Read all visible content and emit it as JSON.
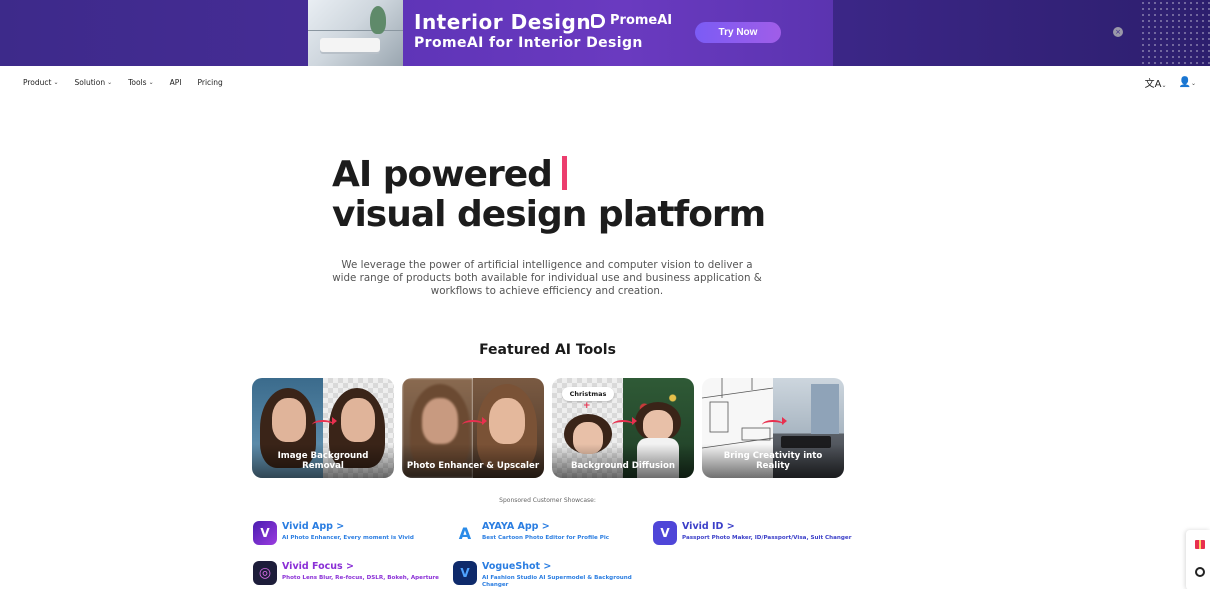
{
  "banner": {
    "title": "Interior Design",
    "subtitle": "PromeAI for Interior Design",
    "brand": "PromeAI",
    "cta": "Try Now",
    "close_glyph": "×"
  },
  "nav": {
    "items": [
      {
        "label": "Product",
        "caret": true
      },
      {
        "label": "Solution",
        "caret": true
      },
      {
        "label": "Tools",
        "caret": true
      },
      {
        "label": "API",
        "caret": false
      },
      {
        "label": "Pricing",
        "caret": false
      }
    ],
    "language_icon": "translate-icon",
    "language_glyph": "文A",
    "user_icon": "user-icon",
    "user_glyph": "👤"
  },
  "hero": {
    "title_line1": "AI powered",
    "title_line2": "visual design platform",
    "description": "We leverage the power of artificial intelligence and computer vision to deliver a wide range of products both available for individual use and business application & workflows to achieve efficiency and creation."
  },
  "featured": {
    "heading": "Featured AI Tools",
    "tools": [
      {
        "label": "Image Background Removal"
      },
      {
        "label": "Photo Enhancer & Upscaler"
      },
      {
        "label": "Background Diffusion",
        "tag": "Christmas",
        "plus": "+"
      },
      {
        "label": "Bring Creativity into Reality"
      }
    ]
  },
  "sponsored": {
    "heading": "Sponsored Customer Showcase:",
    "apps": [
      {
        "name": "Vivid App",
        "chev": ">",
        "desc": "AI Photo Enhancer, Every moment is Vivid",
        "color": "#2a7de1",
        "icon_color": "#6a2bd9",
        "glyph": "V"
      },
      {
        "name": "AYAYA App",
        "chev": ">",
        "desc": "Best Cartoon Photo Editor for Profile Pic",
        "color": "#2a7de1",
        "icon_color": "#ffffff",
        "glyph": "A"
      },
      {
        "name": "Vivid ID",
        "chev": ">",
        "desc": "Passport Photo Maker, ID/Passport/Visa, Suit Changer",
        "color": "#3b3fc8",
        "icon_color": "#4f46d8",
        "glyph": "V"
      },
      {
        "name": "Vivid Focus",
        "chev": ">",
        "desc": "Photo Lens Blur, Re-focus, DSLR, Bokeh, Aperture",
        "color": "#8a2fd6",
        "icon_color": "#1d1d3a",
        "glyph": "◎"
      },
      {
        "name": "VogueShot",
        "chev": ">",
        "desc": "AI Fashion Studio AI Supermodel & Background Changer",
        "color": "#2a7de1",
        "icon_color": "#0e2a6b",
        "glyph": "V"
      }
    ]
  }
}
